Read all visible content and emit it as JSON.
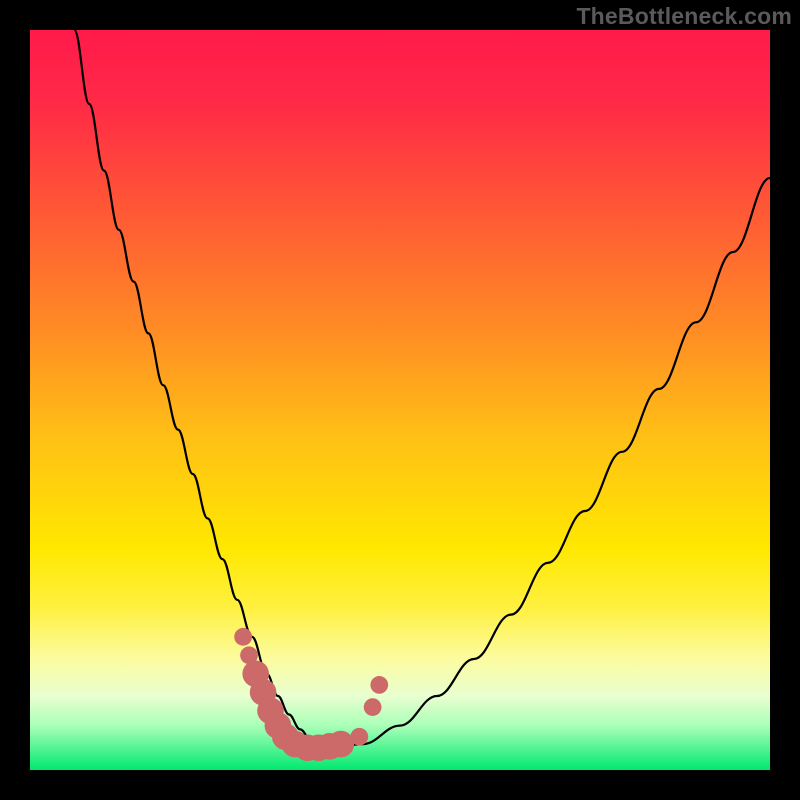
{
  "watermark": "TheBottleneck.com",
  "chart_data": {
    "type": "line",
    "title": "",
    "xlabel": "",
    "ylabel": "",
    "xlim": [
      0,
      100
    ],
    "ylim": [
      0,
      100
    ],
    "background_gradient_stops": [
      {
        "offset": 0.0,
        "color": "#ff1a4a"
      },
      {
        "offset": 0.1,
        "color": "#ff2a46"
      },
      {
        "offset": 0.25,
        "color": "#ff5a35"
      },
      {
        "offset": 0.4,
        "color": "#ff8a25"
      },
      {
        "offset": 0.55,
        "color": "#ffc015"
      },
      {
        "offset": 0.7,
        "color": "#ffe800"
      },
      {
        "offset": 0.78,
        "color": "#fff040"
      },
      {
        "offset": 0.85,
        "color": "#fcfca0"
      },
      {
        "offset": 0.9,
        "color": "#e8ffd0"
      },
      {
        "offset": 0.94,
        "color": "#aaffb8"
      },
      {
        "offset": 1.0,
        "color": "#00e870"
      }
    ],
    "series": [
      {
        "name": "bottleneck-curve",
        "color": "#000000",
        "x": [
          6,
          8,
          10,
          12,
          14,
          16,
          18,
          20,
          22,
          24,
          26,
          28,
          30,
          32,
          33.5,
          35,
          36.5,
          38,
          40,
          45,
          50,
          55,
          60,
          65,
          70,
          75,
          80,
          85,
          90,
          95,
          100
        ],
        "y": [
          100,
          90,
          81,
          73,
          66,
          59,
          52,
          46,
          40,
          34,
          28.5,
          23,
          18,
          13,
          10,
          7.5,
          5.5,
          4,
          3,
          3.5,
          6,
          10,
          15,
          21,
          28,
          35,
          43,
          51.5,
          60.5,
          70,
          80
        ]
      }
    ],
    "markers": [
      {
        "x": 28.8,
        "y": 18.0,
        "r": 1.2,
        "color": "#cc6a6a"
      },
      {
        "x": 29.6,
        "y": 15.5,
        "r": 1.2,
        "color": "#cc6a6a"
      },
      {
        "x": 30.5,
        "y": 13.0,
        "r": 1.8,
        "color": "#cc6a6a"
      },
      {
        "x": 31.5,
        "y": 10.5,
        "r": 1.8,
        "color": "#cc6a6a"
      },
      {
        "x": 32.5,
        "y": 8.0,
        "r": 1.8,
        "color": "#cc6a6a"
      },
      {
        "x": 33.5,
        "y": 6.0,
        "r": 1.8,
        "color": "#cc6a6a"
      },
      {
        "x": 34.5,
        "y": 4.5,
        "r": 1.8,
        "color": "#cc6a6a"
      },
      {
        "x": 35.8,
        "y": 3.5,
        "r": 1.8,
        "color": "#cc6a6a"
      },
      {
        "x": 37.5,
        "y": 3.0,
        "r": 1.8,
        "color": "#cc6a6a"
      },
      {
        "x": 39.0,
        "y": 3.0,
        "r": 1.8,
        "color": "#cc6a6a"
      },
      {
        "x": 40.5,
        "y": 3.2,
        "r": 1.8,
        "color": "#cc6a6a"
      },
      {
        "x": 42.0,
        "y": 3.5,
        "r": 1.8,
        "color": "#cc6a6a"
      },
      {
        "x": 44.5,
        "y": 4.5,
        "r": 1.2,
        "color": "#cc6a6a"
      },
      {
        "x": 46.3,
        "y": 8.5,
        "r": 1.2,
        "color": "#cc6a6a"
      },
      {
        "x": 47.2,
        "y": 11.5,
        "r": 1.2,
        "color": "#cc6a6a"
      }
    ],
    "annotations": []
  }
}
